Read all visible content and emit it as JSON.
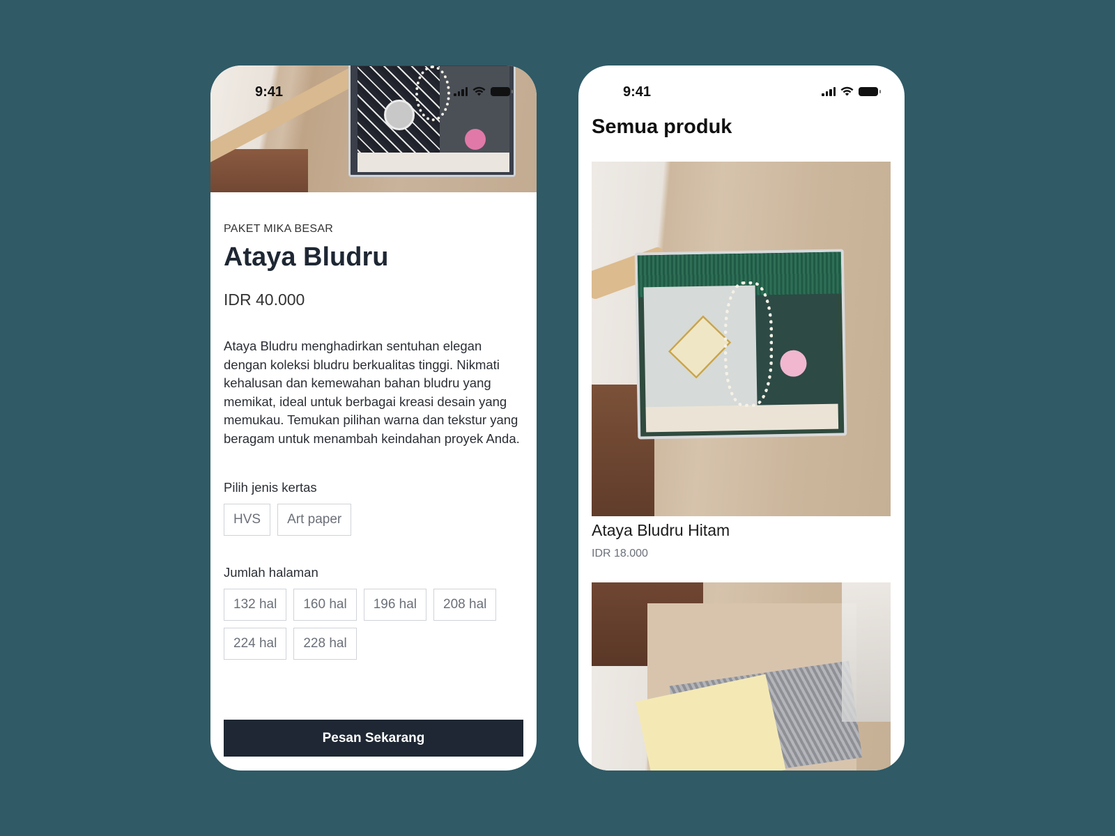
{
  "left_screen": {
    "status_time": "9:41",
    "category": "PAKET MIKA BESAR",
    "title": "Ataya Bludru",
    "price": "IDR 40.000",
    "description": "Ataya Bludru menghadirkan sentuhan elegan dengan koleksi bludru berkualitas tinggi. Nikmati kehalusan dan kemewahan bahan bludru yang memikat, ideal untuk berbagai kreasi desain yang memukau. Temukan pilihan warna dan tekstur yang beragam untuk menambah keindahan proyek Anda.",
    "paper_label": "Pilih jenis kertas",
    "paper_options": [
      "HVS",
      "Art paper"
    ],
    "pages_label": "Jumlah halaman",
    "page_options": [
      "132 hal",
      "160 hal",
      "196 hal",
      "208 hal",
      "224 hal",
      "228 hal"
    ],
    "order_button": "Pesan Sekarang"
  },
  "right_screen": {
    "status_time": "9:41",
    "title": "Semua produk",
    "products": [
      {
        "name": "Ataya Bludru Hitam",
        "price": "IDR 18.000"
      }
    ]
  },
  "colors": {
    "background": "#2f5a66",
    "primary_button": "#1e2733",
    "chip_border": "#cfd3d8"
  },
  "icons": [
    "signal-icon",
    "wifi-icon",
    "battery-icon"
  ]
}
